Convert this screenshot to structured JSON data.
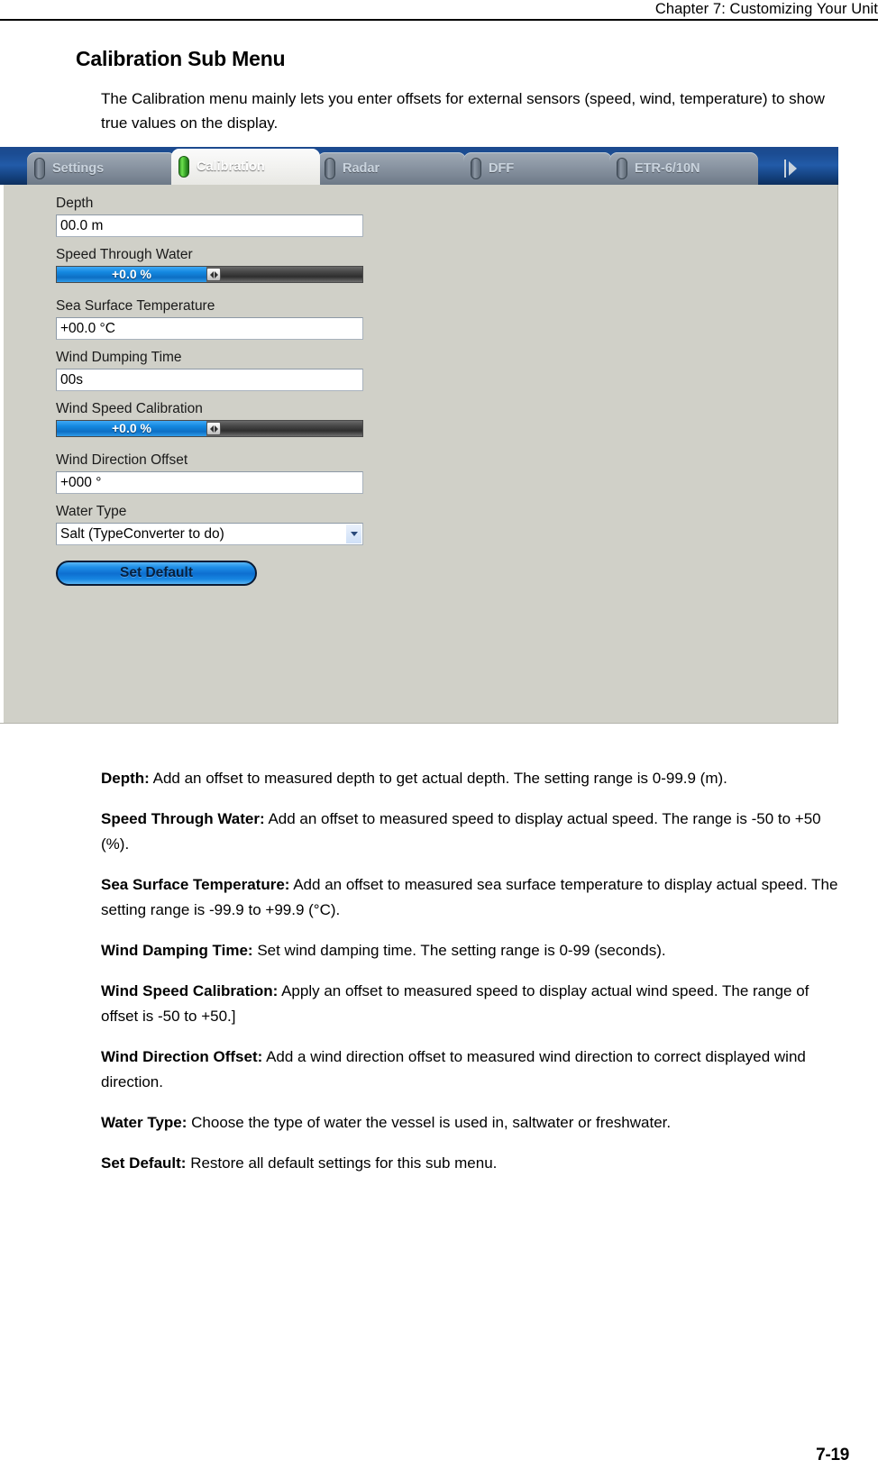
{
  "header": {
    "chapter_title": "Chapter 7: Customizing Your Unit"
  },
  "section": {
    "title": "Calibration Sub Menu",
    "intro": "The Calibration menu mainly lets you enter offsets for external sensors (speed, wind, temperature) to show true values on the display."
  },
  "screenshot": {
    "tabs": [
      {
        "label": "Settings",
        "active": false
      },
      {
        "label": "Calibration",
        "active": true
      },
      {
        "label": "Radar",
        "active": false
      },
      {
        "label": "DFF",
        "active": false
      },
      {
        "label": "ETR-6/10N",
        "active": false
      }
    ],
    "fields": {
      "depth_label": "Depth",
      "depth_value": "00.0 m",
      "speed_label": "Speed Through Water",
      "speed_value": "+0.0 %",
      "sst_label": "Sea Surface Temperature",
      "sst_value": "+00.0 °C",
      "wind_damping_label": "Wind Dumping Time",
      "wind_damping_value": "00s",
      "wind_speed_cal_label": "Wind Speed Calibration",
      "wind_speed_cal_value": "+0.0 %",
      "wind_dir_label": "Wind Direction Offset",
      "wind_dir_value": "+000 °",
      "water_type_label": "Water Type",
      "water_type_value": "Salt (TypeConverter to do)",
      "set_default_label": "Set Default"
    },
    "colors": {
      "titlebar_blue": "#1c4a8e",
      "panel_gray": "#d0d0c8",
      "slider_blue": "#1488e0",
      "button_blue": "#0d6fd0",
      "led_green": "#3aa82a"
    }
  },
  "descriptions": [
    {
      "term": "Depth:",
      "text": " Add an offset to measured depth to get actual depth. The setting range is 0-99.9 (m)."
    },
    {
      "term": "Speed Through Water:",
      "text": " Add an offset to measured speed to display actual speed. The range is -50 to +50 (%)."
    },
    {
      "term": "Sea Surface Temperature:",
      "text": " Add an offset to measured sea surface temperature to display actual speed. The setting range is -99.9 to +99.9 (°C)."
    },
    {
      "term": "Wind Damping Time:",
      "text": " Set wind damping time. The setting range is 0-99 (seconds)."
    },
    {
      "term": "Wind Speed Calibration:",
      "text": " Apply an offset to measured speed to display actual wind speed. The range of offset is -50 to +50.]"
    },
    {
      "term": "Wind Direction Offset:",
      "text": " Add a wind direction offset to measured wind direction to correct displayed wind direction."
    },
    {
      "term": "Water Type:",
      "text": " Choose the type of water the vessel is used in, saltwater or freshwater."
    },
    {
      "term": "Set Default:",
      "text": " Restore all default settings for this sub menu."
    }
  ],
  "footer": {
    "page_number": "7-19"
  }
}
